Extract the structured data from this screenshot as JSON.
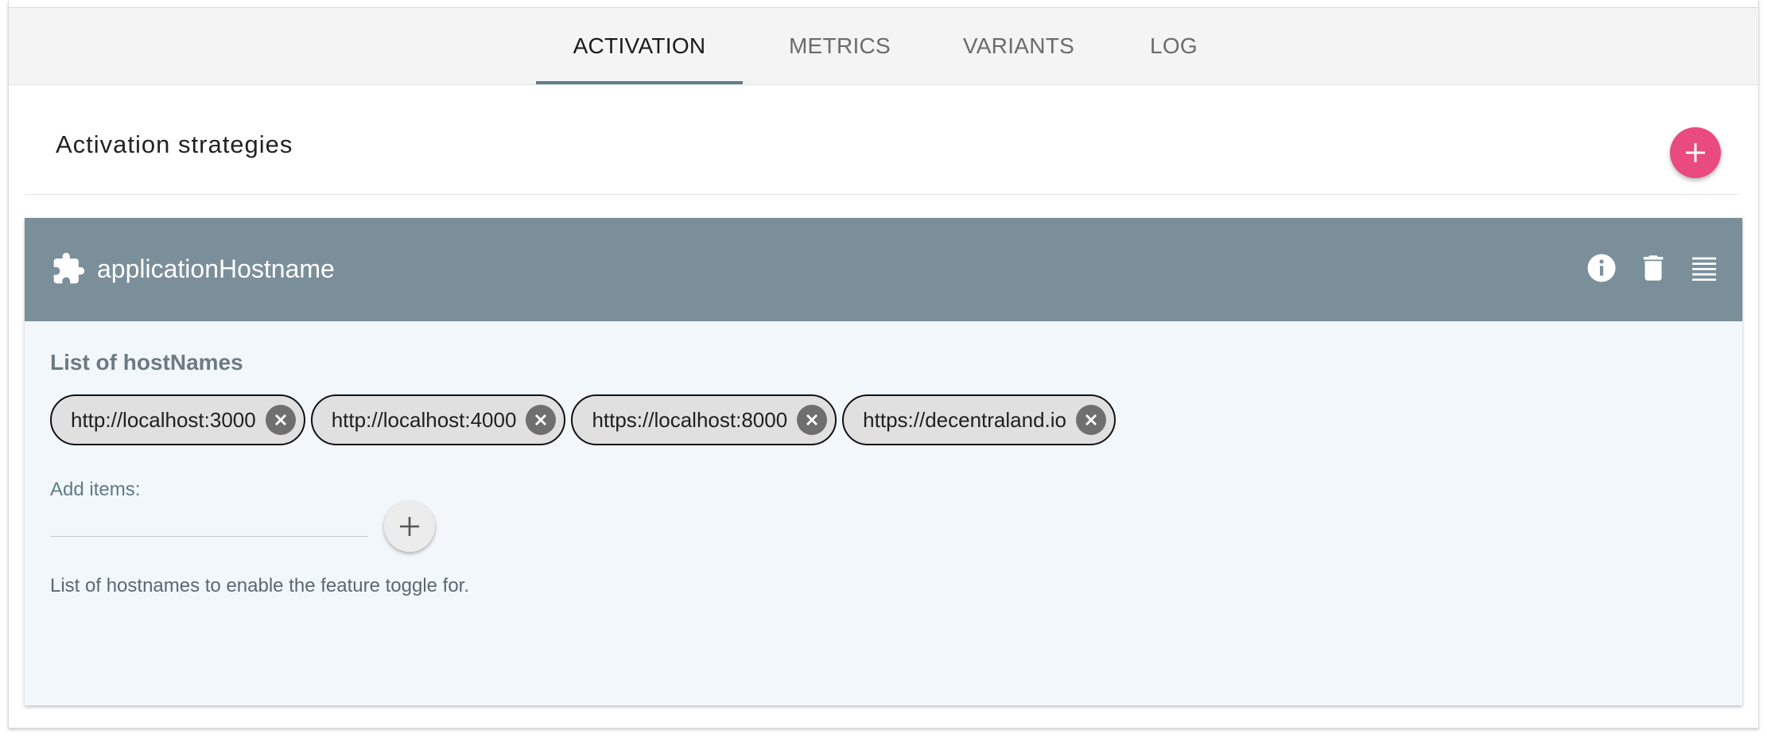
{
  "tabs": [
    {
      "label": "ACTIVATION",
      "active": true
    },
    {
      "label": "METRICS",
      "active": false
    },
    {
      "label": "VARIANTS",
      "active": false
    },
    {
      "label": "LOG",
      "active": false
    }
  ],
  "section": {
    "title": "Activation strategies",
    "add_icon": "plus-icon"
  },
  "strategy": {
    "name": "applicationHostname",
    "icon": "puzzle-icon",
    "actions": [
      "info-icon",
      "trash-icon",
      "drag-handle-icon"
    ],
    "list_title": "List of hostNames",
    "chips": [
      "http://localhost:3000",
      "http://localhost:4000",
      "https://localhost:8000",
      "https://decentraland.io"
    ],
    "add_label": "Add items:",
    "add_input_value": "",
    "help_text": "List of hostnames to enable the feature toggle for."
  },
  "colors": {
    "accent": "#e94a7f",
    "strategy_header": "#7b8f9b",
    "strategy_body": "#f2f7fb",
    "tab_indicator": "#607d8b"
  }
}
